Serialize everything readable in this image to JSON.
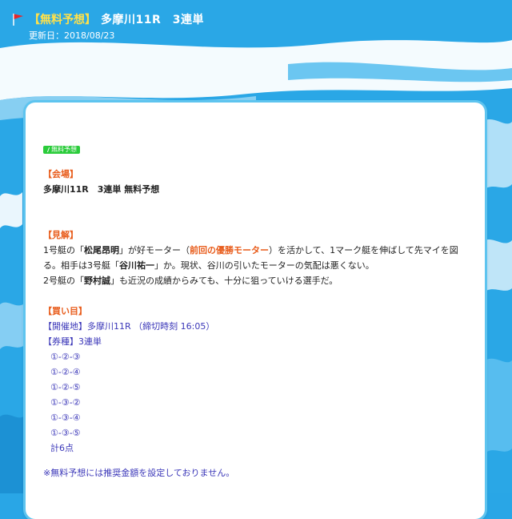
{
  "header": {
    "tag": "【無料予想】",
    "title": "多摩川11R　3連単",
    "updated": "更新日：2018/08/23"
  },
  "badge": "無料予想",
  "venue": {
    "heading": "【会場】",
    "text": "多摩川11R　3連単 無料予想"
  },
  "opinion": {
    "heading": "【見解】",
    "line1_a": "1号艇の「",
    "line1_name": "松尾昂明",
    "line1_b": "」が好モーター（",
    "line1_motor": "前回の優勝モーター",
    "line1_c": "）を活かして、1マーク艇を伸ばして先マイを図",
    "line2_a": "る。相手は3号艇「",
    "line2_name": "谷川祐一",
    "line2_b": "」か。現状、谷川の引いたモーターの気配は悪くない。",
    "line3_a": "2号艇の「",
    "line3_name": "野村誠",
    "line3_b": "」も近況の成績からみても、十分に狙っていける選手だ。"
  },
  "picks": {
    "heading": "【買い目】",
    "venue_line": "【開催地】多摩川11R （締切時刻 16:05）",
    "type_line": "【券種】3連単",
    "combos": [
      "①-②-③",
      "①-②-④",
      "①-②-⑤",
      "①-③-②",
      "①-③-④",
      "①-③-⑤"
    ],
    "total": "計6点"
  },
  "note": "※無料予想には推奨金額を設定しておりません。",
  "colors": {
    "accent_orange": "#e85c1b",
    "link_blue": "#3a36b8",
    "badge_green": "#2bcc3b",
    "background_blue": "#29a6e6",
    "title_yellow": "#ffe14a"
  },
  "icons": {
    "flag": "red-flag-icon"
  }
}
